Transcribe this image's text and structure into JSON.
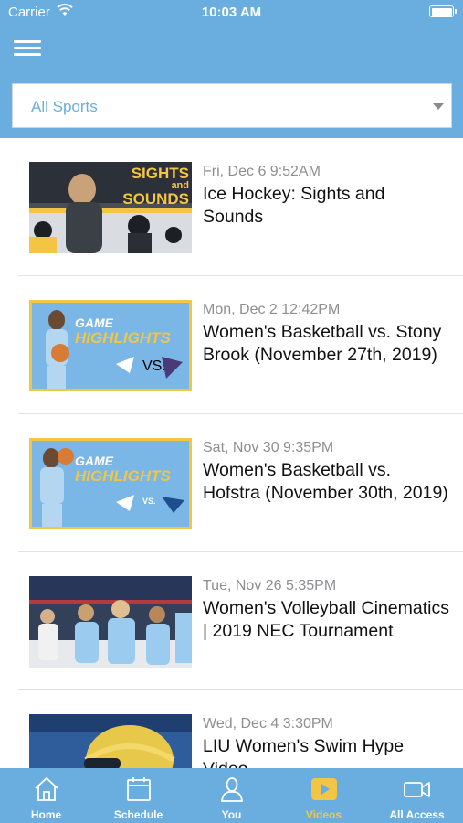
{
  "status_bar": {
    "carrier": "Carrier",
    "time": "10:03 AM"
  },
  "header": {
    "menu_icon": "hamburger-menu-icon"
  },
  "filter": {
    "selected": "All Sports"
  },
  "videos": [
    {
      "date": "Fri, Dec 6 9:52AM",
      "title": "Ice Hockey: Sights and Sounds",
      "thumb_text": [
        "SIGHTS",
        "and",
        "SOUNDS"
      ]
    },
    {
      "date": "Mon, Dec 2 12:42PM",
      "title": "Women's Basketball vs. Stony Brook (November 27th, 2019)",
      "thumb_text": [
        "GAME",
        "HIGHLIGHTS",
        "VS."
      ]
    },
    {
      "date": "Sat, Nov 30 9:35PM",
      "title": "Women's Basketball vs. Hofstra (November 30th, 2019)",
      "thumb_text": [
        "GAME",
        "HIGHLIGHTS",
        "VS."
      ]
    },
    {
      "date": "Tue, Nov 26 5:35PM",
      "title": "Women's Volleyball Cinematics | 2019 NEC Tournament"
    },
    {
      "date": "Wed, Dec 4 3:30PM",
      "title": "LIU Women's Swim Hype Video"
    }
  ],
  "tabs": [
    {
      "label": "Home",
      "icon": "home-icon"
    },
    {
      "label": "Schedule",
      "icon": "calendar-icon"
    },
    {
      "label": "You",
      "icon": "person-icon"
    },
    {
      "label": "Videos",
      "icon": "play-icon",
      "active": true
    },
    {
      "label": "All Access",
      "icon": "video-camera-icon"
    }
  ],
  "colors": {
    "brand": "#6aaedf",
    "active_tab": "#f3c545",
    "thumb_accent": "#f3c545"
  }
}
